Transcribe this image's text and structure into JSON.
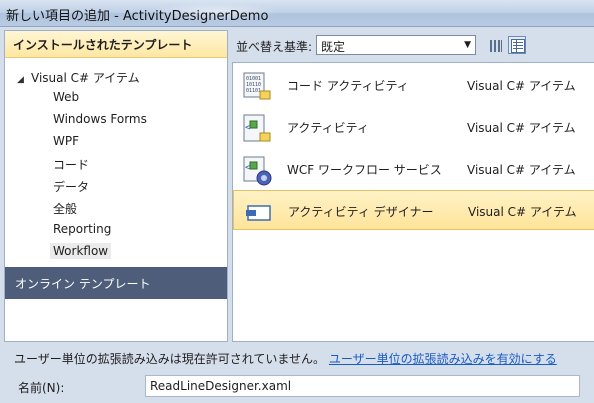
{
  "window": {
    "title": "新しい項目の追加 - ActivityDesignerDemo"
  },
  "left": {
    "header": "インストールされたテンプレート",
    "tree_root": "Visual C# アイテム",
    "tree_items": [
      "Web",
      "Windows Forms",
      "WPF",
      "コード",
      "データ",
      "全般",
      "Reporting",
      "Workflow"
    ],
    "selected_item": "Workflow",
    "online": "オンライン テンプレート"
  },
  "toolbar": {
    "sort_label": "並べ替え基準:",
    "sort_value": "既定"
  },
  "templates": [
    {
      "name": "コード アクティビティ",
      "type": "Visual C# アイテム",
      "icon": "code-activity-icon"
    },
    {
      "name": "アクティビティ",
      "type": "Visual C# アイテム",
      "icon": "activity-icon"
    },
    {
      "name": "WCF ワークフロー サービス",
      "type": "Visual C# アイテム",
      "icon": "wcf-workflow-service-icon"
    },
    {
      "name": "アクティビティ デザイナー",
      "type": "Visual C# アイテム",
      "icon": "activity-designer-icon"
    }
  ],
  "selected_template": "アクティビティ デザイナー",
  "bottom": {
    "info": "ユーザー単位の拡張読み込みは現在許可されていません。",
    "link": "ユーザー単位の拡張読み込みを有効にする",
    "name_label": "名前(N):",
    "name_value": "ReadLineDesigner.xaml"
  },
  "colors": {
    "online_bar": "#4d5d7a",
    "selection": "#ffe49a",
    "link": "#1a5bc4"
  }
}
